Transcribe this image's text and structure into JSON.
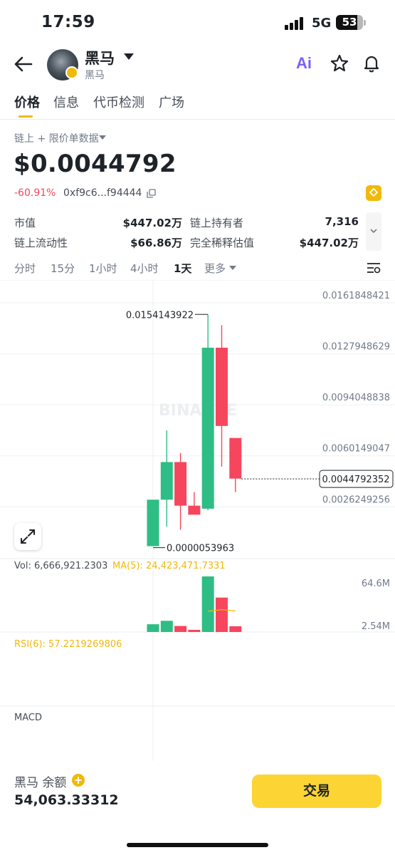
{
  "status": {
    "time": "17:59",
    "network": "5G",
    "battery": "53"
  },
  "header": {
    "coin_name": "黑马",
    "coin_sub": "黑马",
    "ai_label": "Ai"
  },
  "tabs": [
    "价格",
    "信息",
    "代币检测",
    "广场"
  ],
  "price_section": {
    "data_source": "链上 + 限价单数据",
    "price": "$0.0044792",
    "change": "-60.91%",
    "address": "0xf9c6...f94444"
  },
  "stats": [
    {
      "label": "市值",
      "value": "$447.02万"
    },
    {
      "label": "链上持有者",
      "value": "7,316"
    },
    {
      "label": "链上流动性",
      "value": "$66.86万"
    },
    {
      "label": "完全稀释估值",
      "value": "$447.02万"
    }
  ],
  "intervals": [
    "分时",
    "15分",
    "1小时",
    "4小时",
    "1天",
    "更多"
  ],
  "active_interval": "1天",
  "chart_data": {
    "type": "candlestick",
    "watermark": "BINANCE",
    "y_axis_labels": [
      "0.0161848421",
      "0.0127948629",
      "0.0094048838",
      "0.0060149047",
      "0.0026249256"
    ],
    "ylim": [
      -0.00077,
      0.0177
    ],
    "current_price_label": "0.0044792352",
    "current_price": 0.0044792352,
    "high_annotation": "0.0154143922",
    "high_value": 0.0154143922,
    "low_annotation": "0.0000053963",
    "low_value": 5.3963e-06,
    "candles": [
      {
        "open": 1e-05,
        "high": 0.0023,
        "low": 5.4e-06,
        "close": 0.0031
      },
      {
        "open": 0.0031,
        "high": 0.0077,
        "low": 0.0013,
        "close": 0.0056
      },
      {
        "open": 0.0056,
        "high": 0.0062,
        "low": 0.0011,
        "close": 0.0027
      },
      {
        "open": 0.0027,
        "high": 0.0036,
        "low": 0.0022,
        "close": 0.0021
      },
      {
        "open": 0.0025,
        "high": 0.0154,
        "low": 0.0024,
        "close": 0.0132
      },
      {
        "open": 0.0132,
        "high": 0.0147,
        "low": 0.0053,
        "close": 0.008
      },
      {
        "open": 0.0072,
        "high": 0.0072,
        "low": 0.0036,
        "close": 0.0045
      }
    ],
    "colors": {
      "up": "#2ebd85",
      "down": "#f6465d"
    },
    "volume": {
      "label": "Vol: 6,666,921.2303",
      "ma_label": "MA(5): 24,423,471.7331",
      "y_axis_labels": [
        "64.6M",
        "2.54M"
      ],
      "ylim": [
        0,
        64600000
      ],
      "values": [
        9000000,
        13000000,
        7000000,
        2500000,
        64600000,
        40000000,
        6666921
      ],
      "ma": [
        24000000,
        26000000,
        24423471
      ]
    },
    "rsi_label": "RSI(6): 57.2219269806",
    "macd_label": "MACD"
  },
  "bottom": {
    "balance_label": "黑马 余额",
    "balance_value": "54,063.33312",
    "trade_label": "交易"
  }
}
